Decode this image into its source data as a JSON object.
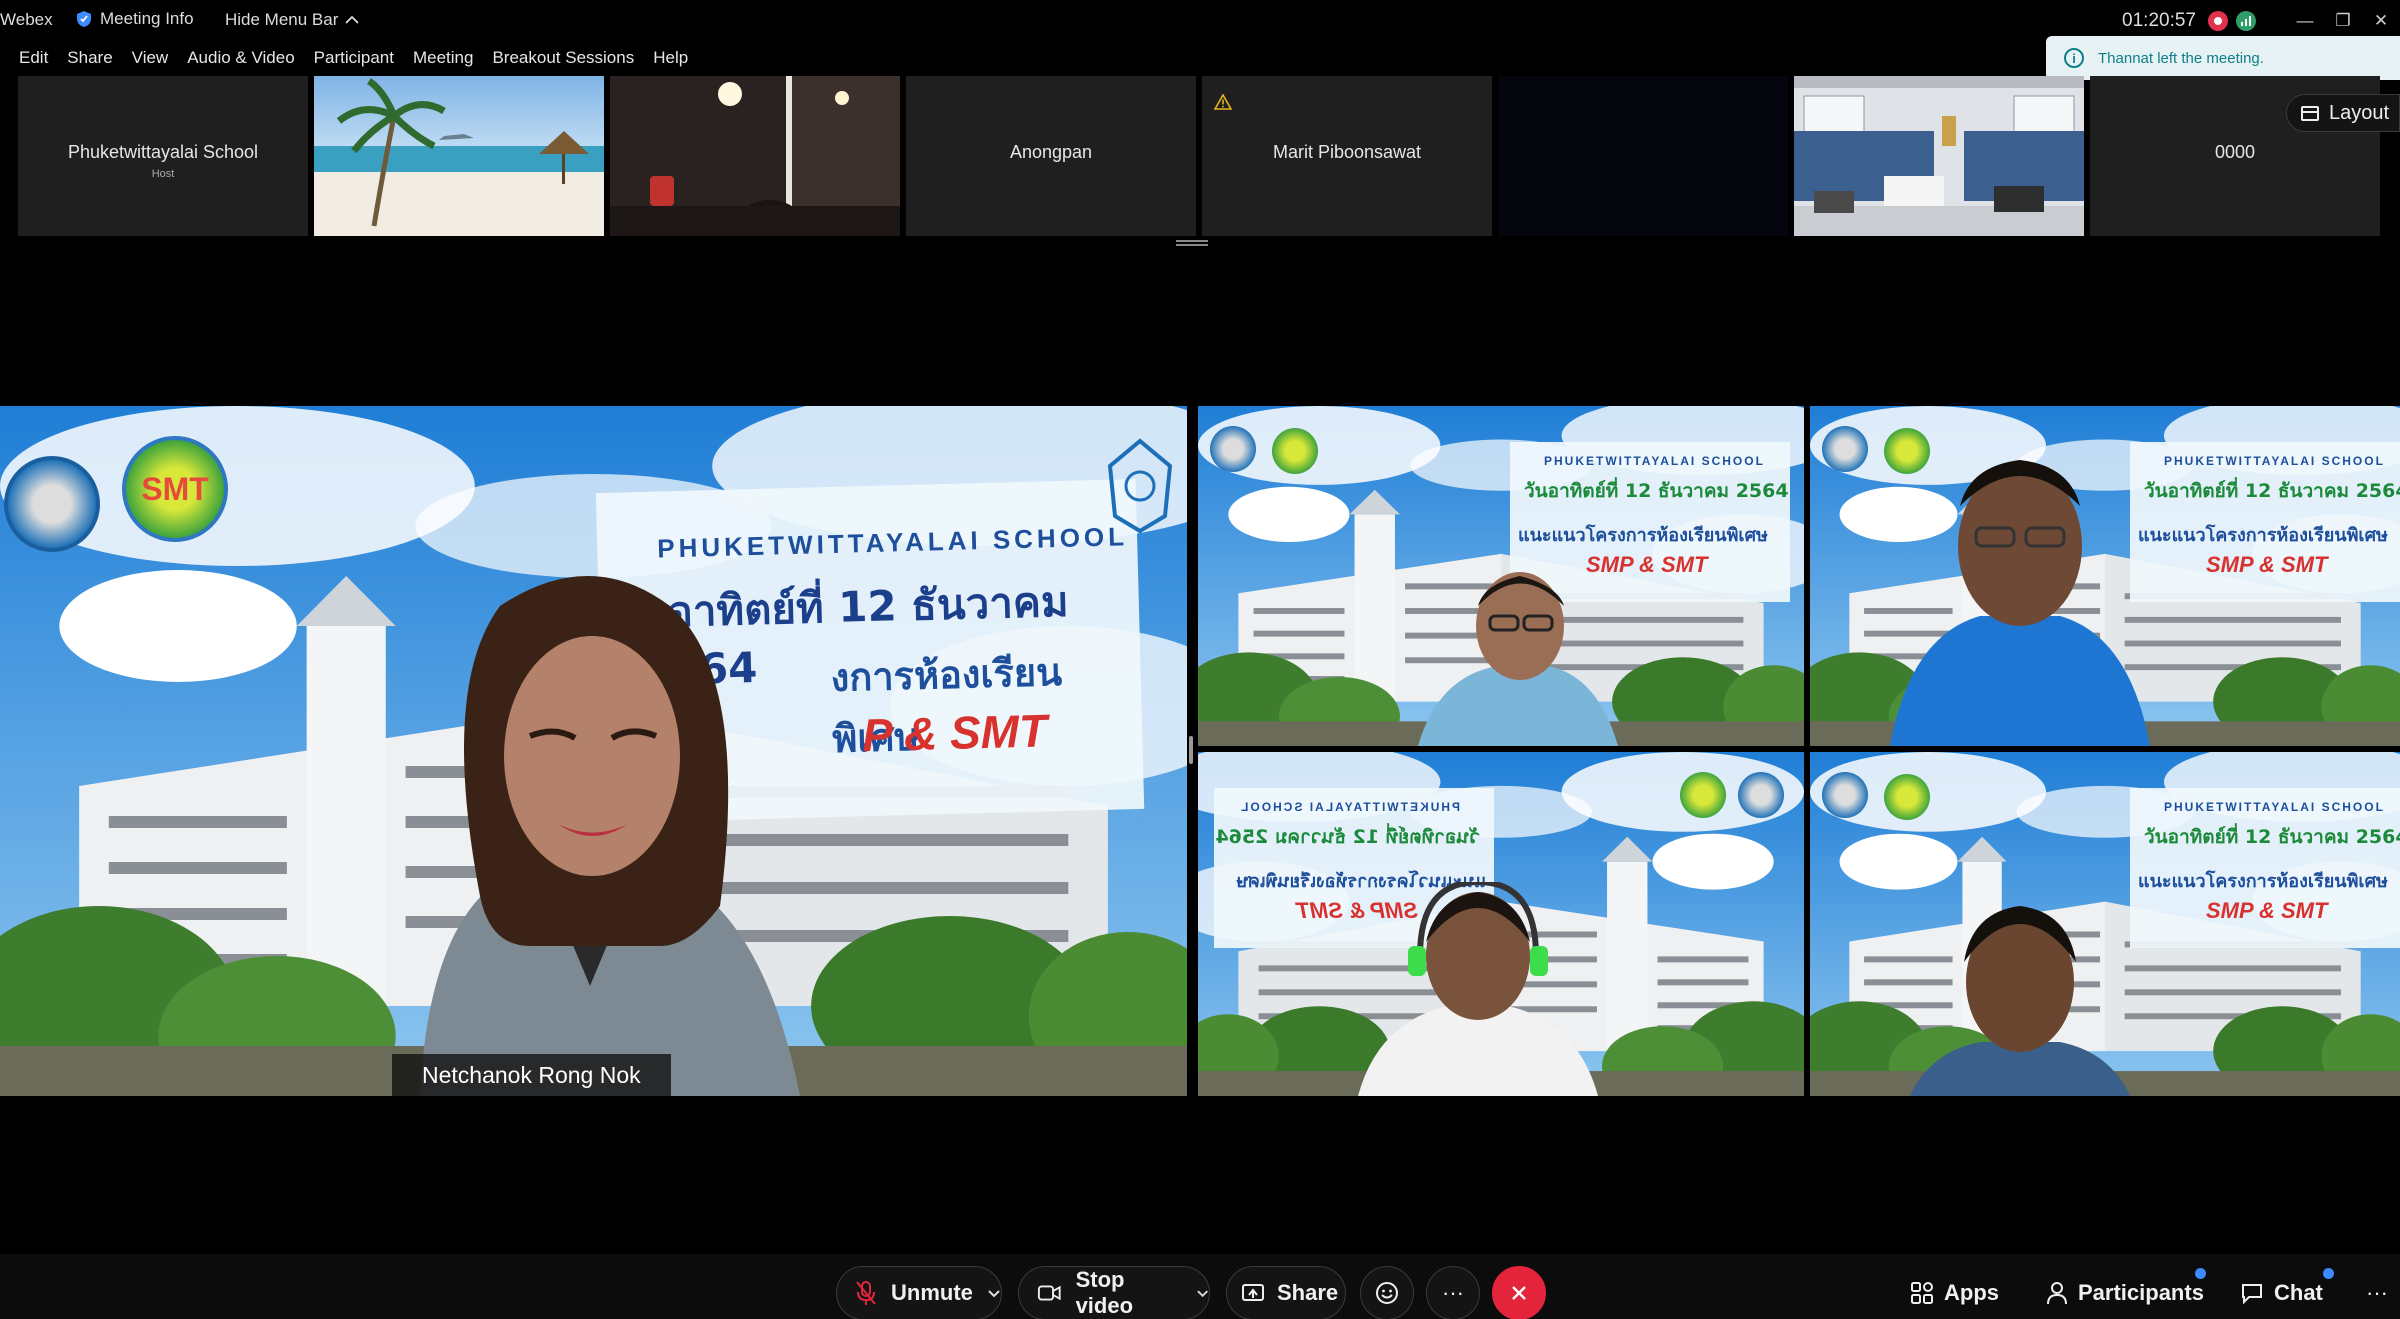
{
  "window": {
    "app_name": "Webex",
    "meeting_info": "Meeting Info",
    "hide_menu_bar": "Hide Menu Bar",
    "time": "01:20:57",
    "controls": {
      "minimize": "—",
      "restore": "❐",
      "close": "✕"
    }
  },
  "menu": [
    "Edit",
    "Share",
    "View",
    "Audio & Video",
    "Participant",
    "Meeting",
    "Breakout Sessions",
    "Help"
  ],
  "notification": {
    "text": "Thannat  left the meeting.",
    "color": "#0e7f8a"
  },
  "layout_button": "Layout",
  "thumbnails": [
    {
      "name": "Phuketwittayalai School",
      "role": "Host",
      "kind": "name"
    },
    {
      "name": "",
      "kind": "beach"
    },
    {
      "name": "",
      "kind": "dark-room"
    },
    {
      "name": "Anongpan",
      "kind": "name"
    },
    {
      "name": "Marit Piboonsawat",
      "kind": "name-warning"
    },
    {
      "name": "",
      "kind": "black"
    },
    {
      "name": "",
      "kind": "classroom"
    },
    {
      "name": "0000",
      "kind": "name"
    }
  ],
  "main_speaker": {
    "name": "Netchanok Rong Nok",
    "banner": {
      "school": "PHUKETWITTAYALAI SCHOOL",
      "date_line": "ันอาทิตย์ที่ 12 ธันวาคม 2564",
      "program_line": "งการห้องเรียนพิเศษ",
      "program_code": "P & SMT"
    }
  },
  "grid_banners": [
    {
      "school": "PHUKETWITTAYALAI SCHOOL",
      "date_line": "วันอาทิตย์ที่ 12 ธันวาคม 2564",
      "program_line": "แนะแนวโครงการห้องเรียนพิเศษ",
      "program_code": "SMP & SMT"
    },
    {
      "school": "PHUKETWITTAYALAI SCHOOL",
      "date_line": "วันอาทิตย์ที่ 12 ธันวาคม 2564",
      "program_line": "แนะแนวโครงการห้องเรียนพิเศษ",
      "program_code": "SMP & SMT"
    },
    {
      "school": "PHUKETWITTAYALAI SCHOOL",
      "date_line": "วันอาทิตย์ที่ 12 ธันวาคม 2564",
      "program_line": "แนะแนวโครงการห้องเรียนพิเศษ",
      "program_code": "SMP & SMT"
    },
    {
      "school": "PHUKETWITTAYALAI SCHOOL",
      "date_line": "วันอาทิตย์ที่ 12 ธันวาคม 2564",
      "program_line": "แนะแนวโครงการห้องเรียนพิเศษ",
      "program_code": "SMP & SMT"
    }
  ],
  "logos": {
    "smp": "SMP",
    "smt": "SMT"
  },
  "toolbar": {
    "unmute": "Unmute",
    "stop_video": "Stop video",
    "share": "Share",
    "more": "···",
    "apps": "Apps",
    "participants": "Participants",
    "chat": "Chat",
    "overflow": "···"
  },
  "colors": {
    "end_call": "#e3243b",
    "recording": "#e0334d",
    "badge": "#3d8bff",
    "banner_blue": "#1d4f9c",
    "banner_green": "#1c8a3a",
    "banner_red": "#d8322f"
  }
}
